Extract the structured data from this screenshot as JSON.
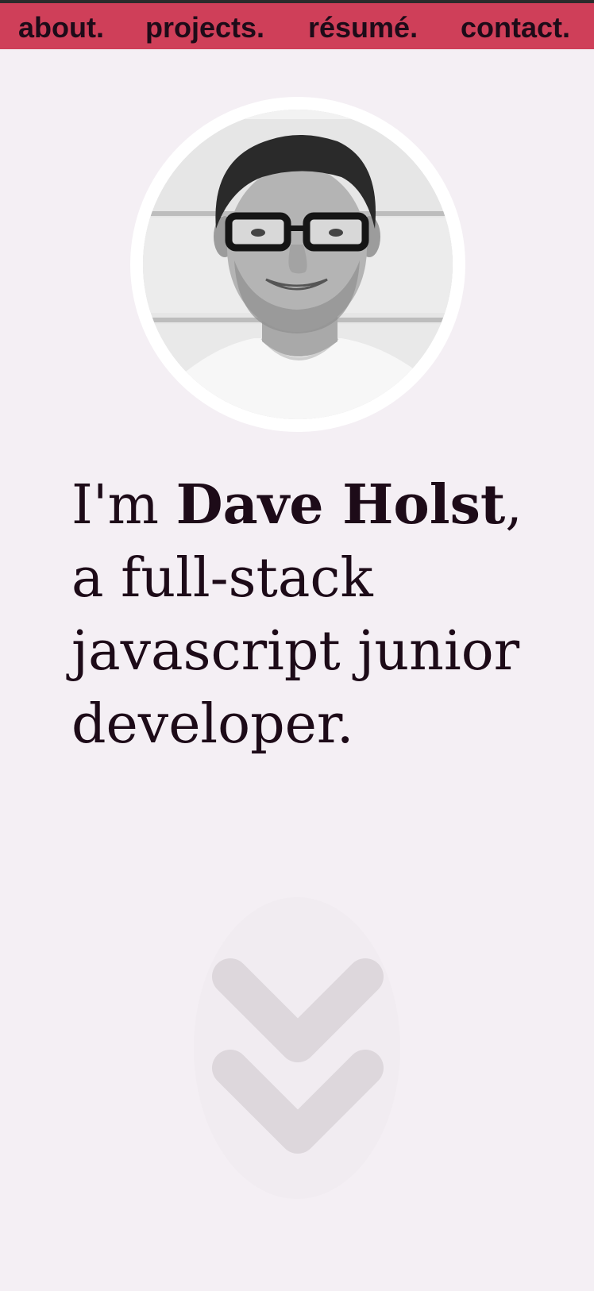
{
  "nav": {
    "items": [
      {
        "label": "about."
      },
      {
        "label": "projects."
      },
      {
        "label": "résumé."
      },
      {
        "label": "contact."
      }
    ]
  },
  "intro": {
    "prefix": "I'm ",
    "name": "Dave Holst",
    "comma": ",",
    "line2": "a full-stack",
    "line3": "javascript junior",
    "line4": "developer."
  },
  "scroll": {
    "icon": "double-chevron-down-icon"
  },
  "colors": {
    "nav_background": "#cf3f59",
    "page_background": "#f4eff4",
    "text": "#1d0b18",
    "chevron": "#ddd7dc"
  }
}
